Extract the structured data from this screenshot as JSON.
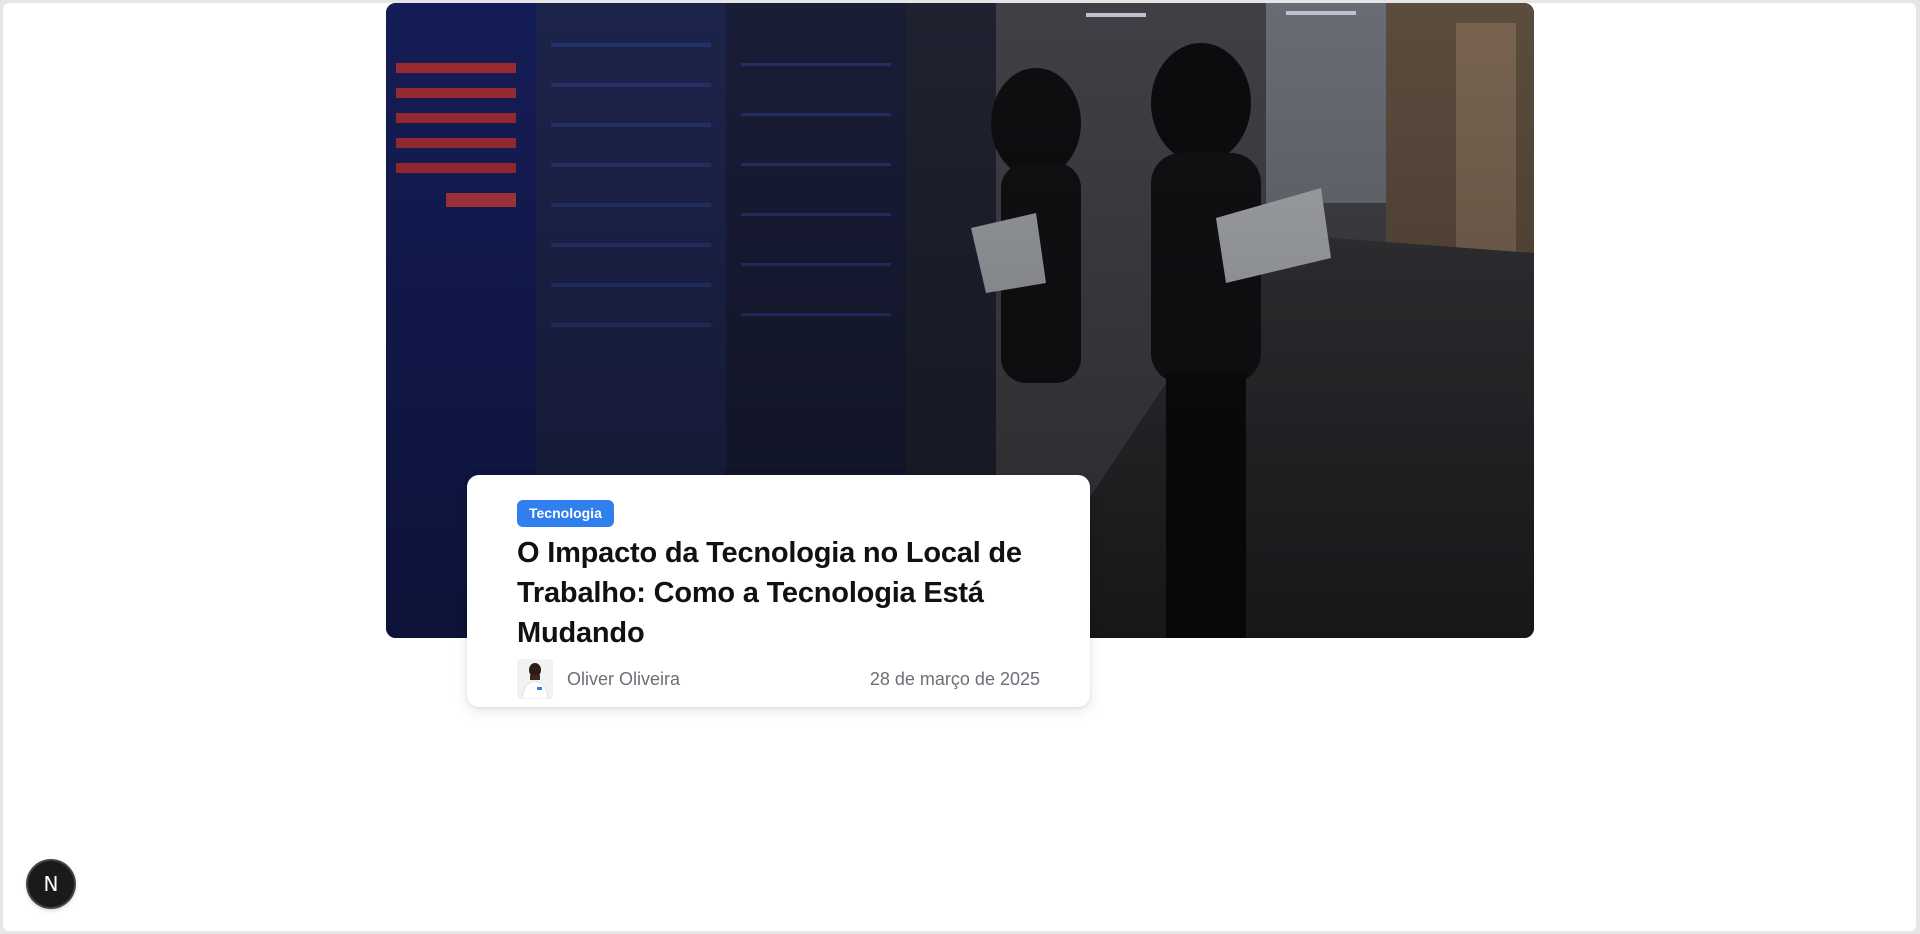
{
  "hero": {
    "image_icon": "office-datacenter-photo"
  },
  "card": {
    "category": "Tecnologia",
    "title": "O Impacto da Tecnologia no Local de Trabalho: Como a Tecnologia Está Mudando",
    "author": "Oliver Oliveira",
    "date": "28 de março de 2025"
  },
  "floating_button": {
    "label": "N",
    "icon": "nextjs-logo-icon"
  },
  "colors": {
    "accent": "#2f7fef",
    "title": "#111111",
    "meta": "#6b6f76"
  }
}
